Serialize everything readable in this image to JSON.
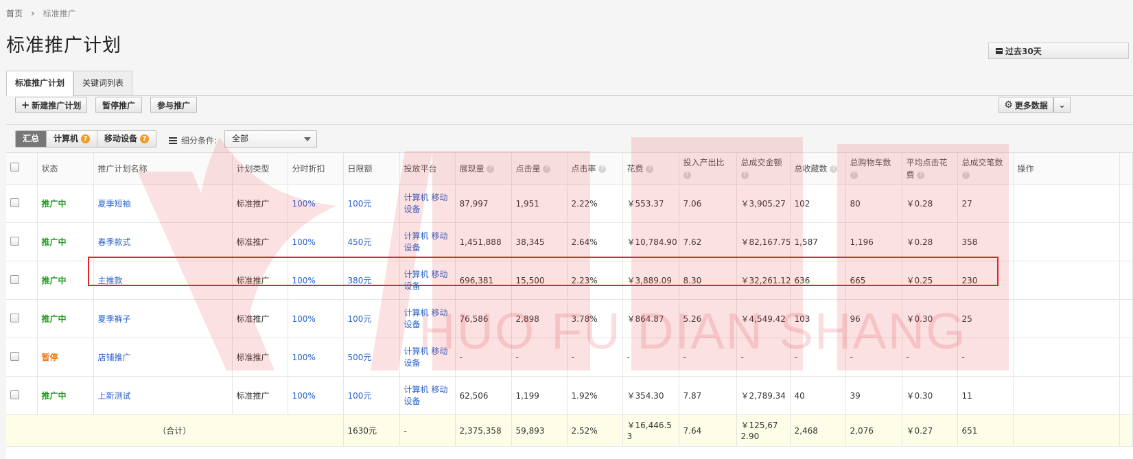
{
  "breadcrumb": {
    "home": "首页",
    "current": "标准推广"
  },
  "page_title": "标准推广计划",
  "date_range": "过去30天",
  "tabs": [
    {
      "label": "标准推广计划"
    },
    {
      "label": "关键词列表"
    }
  ],
  "toolbar": {
    "new_plan": "新建推广计划",
    "pause": "暂停推广",
    "join": "参与推广",
    "more_data": "更多数据"
  },
  "filters": {
    "segments": [
      "汇总",
      "计算机",
      "移动设备"
    ],
    "condition_label": "细分条件:",
    "condition_value": "全部"
  },
  "table": {
    "headers": [
      "状态",
      "推广计划名称",
      "计划类型",
      "分时折扣",
      "日限额",
      "投放平台",
      "展现量",
      "点击量",
      "点击率",
      "花费",
      "投入产出比",
      "总成交金额",
      "总收藏数",
      "总购物车数",
      "平均点击花费",
      "总成交笔数",
      "操作"
    ],
    "rows": [
      {
        "status": "推广中",
        "name": "夏季短袖",
        "type": "标准推广",
        "discount": "100%",
        "limit": "100元",
        "platform": "计算机 移动设备",
        "impressions": "87,997",
        "clicks": "1,951",
        "ctr": "2.22%",
        "cost": "￥553.37",
        "roi": "7.06",
        "gmv": "￥3,905.27",
        "fav": "102",
        "cart": "80",
        "cpc": "￥0.28",
        "orders": "27"
      },
      {
        "status": "推广中",
        "name": "春季款式",
        "type": "标准推广",
        "discount": "100%",
        "limit": "450元",
        "platform": "计算机 移动设备",
        "impressions": "1,451,888",
        "clicks": "38,345",
        "ctr": "2.64%",
        "cost": "￥10,784.90",
        "roi": "7.62",
        "gmv": "￥82,167.75",
        "fav": "1,587",
        "cart": "1,196",
        "cpc": "￥0.28",
        "orders": "358"
      },
      {
        "status": "推广中",
        "name": "主推款",
        "type": "标准推广",
        "discount": "100%",
        "limit": "380元",
        "platform": "计算机 移动设备",
        "impressions": "696,381",
        "clicks": "15,500",
        "ctr": "2.23%",
        "cost": "￥3,889.09",
        "roi": "8.30",
        "gmv": "￥32,261.12",
        "fav": "636",
        "cart": "665",
        "cpc": "￥0.25",
        "orders": "230"
      },
      {
        "status": "推广中",
        "name": "夏季裤子",
        "type": "标准推广",
        "discount": "100%",
        "limit": "100元",
        "platform": "计算机 移动设备",
        "impressions": "76,586",
        "clicks": "2,898",
        "ctr": "3.78%",
        "cost": "￥864.87",
        "roi": "5.26",
        "gmv": "￥4,549.42",
        "fav": "103",
        "cart": "96",
        "cpc": "￥0.30",
        "orders": "25"
      },
      {
        "status": "暂停",
        "name": "店铺推广",
        "type": "标准推广",
        "discount": "100%",
        "limit": "500元",
        "platform": "计算机 移动设备",
        "impressions": "-",
        "clicks": "-",
        "ctr": "-",
        "cost": "-",
        "roi": "-",
        "gmv": "-",
        "fav": "-",
        "cart": "-",
        "cpc": "-",
        "orders": "-"
      },
      {
        "status": "推广中",
        "name": "上新测试",
        "type": "标准推广",
        "discount": "100%",
        "limit": "100元",
        "platform": "计算机 移动设备",
        "impressions": "62,506",
        "clicks": "1,199",
        "ctr": "1.92%",
        "cost": "￥354.30",
        "roi": "7.87",
        "gmv": "￥2,789.34",
        "fav": "40",
        "cart": "39",
        "cpc": "￥0.30",
        "orders": "11"
      }
    ],
    "total": {
      "label": "（合计）",
      "limit": "1630元",
      "platform": "-",
      "impressions": "2,375,358",
      "clicks": "59,893",
      "ctr": "2.52%",
      "cost": "￥16,446.53",
      "roi": "7.64",
      "gmv": "￥125,672.90",
      "fav": "2,468",
      "cart": "2,076",
      "cpc": "￥0.27",
      "orders": "651"
    }
  },
  "watermark": {
    "text": "HUO FU DIAN SHANG"
  },
  "colors": {
    "active_status": "#1a9c1a",
    "paused_status": "#f07c1a",
    "link": "#2763c9",
    "highlight": "#e0242a",
    "watermark": "#e8323a"
  }
}
